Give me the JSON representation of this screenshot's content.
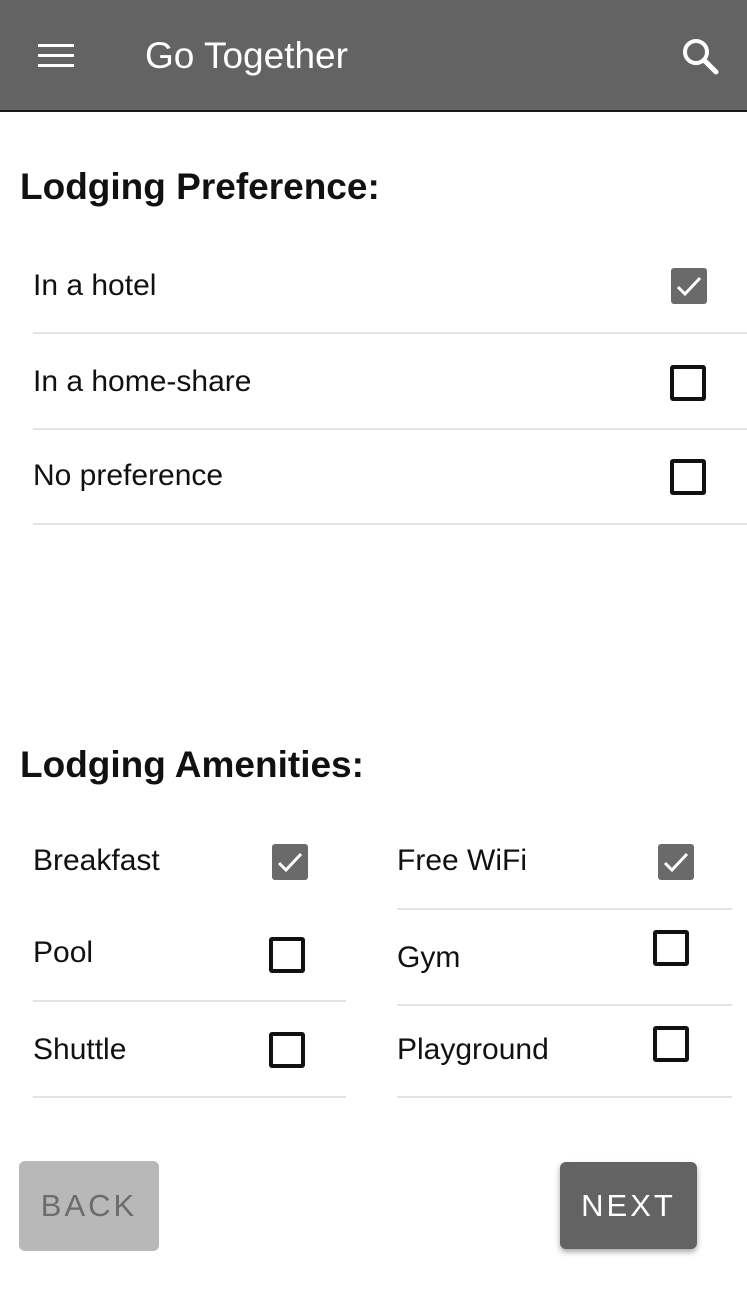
{
  "appbar": {
    "title": "Go Together",
    "menu_icon": "hamburger-menu-icon",
    "search_icon": "search-icon",
    "background": "#636363"
  },
  "lodging_preference": {
    "heading": "Lodging Preference:",
    "options": [
      {
        "label": "In a hotel",
        "checked": true
      },
      {
        "label": "In a home-share",
        "checked": false
      },
      {
        "label": "No preference",
        "checked": false
      }
    ]
  },
  "lodging_amenities": {
    "heading": "Lodging Amenities:",
    "left": [
      {
        "label": "Breakfast",
        "checked": true
      },
      {
        "label": "Pool",
        "checked": false
      },
      {
        "label": "Shuttle",
        "checked": false
      }
    ],
    "right": [
      {
        "label": "Free WiFi",
        "checked": true
      },
      {
        "label": "Gym",
        "checked": false
      },
      {
        "label": "Playground",
        "checked": false
      }
    ]
  },
  "buttons": {
    "back": "BACK",
    "next": "NEXT"
  },
  "colors": {
    "checked_fill": "#6a6a6a",
    "divider": "#e3e3e3",
    "back_disabled": "#b8b8b8",
    "next_primary": "#636363"
  }
}
